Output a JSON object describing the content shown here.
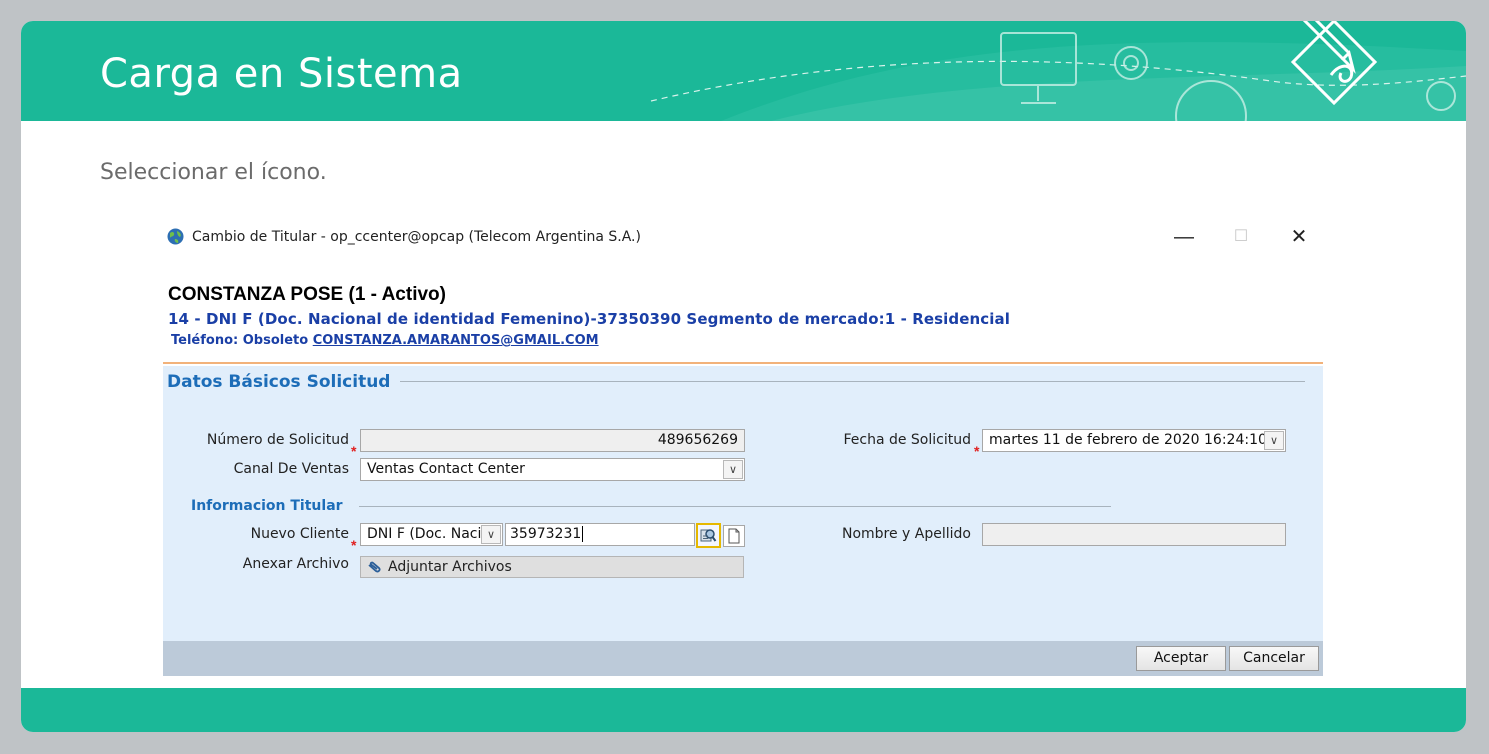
{
  "slide": {
    "title": "Carga en Sistema",
    "instruction": "Seleccionar el ícono.",
    "accent_color": "#1bb898"
  },
  "window": {
    "title": "Cambio de Titular - op_ccenter@opcap (Telecom Argentina S.A.)",
    "controls": {
      "minimize": "—",
      "maximize": "☐",
      "close": "✕"
    }
  },
  "customer": {
    "name": "CONSTANZA POSE (1 - Activo)",
    "doc_line": "14 - DNI F (Doc. Nacional de identidad Femenino)-37350390 Segmento de mercado:1 - Residencial",
    "phone_label": "Teléfono: Obsoleto",
    "email": "CONSTANZA.AMARANTOS@GMAIL.COM"
  },
  "form": {
    "section_title": "Datos Básicos Solicitud",
    "numero_label": "Número de Solicitud",
    "numero_value": "489656269",
    "fecha_label": "Fecha de Solicitud",
    "fecha_value": "martes 11 de febrero de 2020 16:24:10",
    "canal_label": "Canal De Ventas",
    "canal_value": "Ventas Contact Center",
    "subsection_title": "Informacion Titular",
    "nuevo_label": "Nuevo Cliente",
    "doc_type_value": "DNI F (Doc. Naci",
    "doc_number_value": "35973231",
    "nombre_label": "Nombre y Apellido",
    "nombre_value": "",
    "anexar_label": "Anexar Archivo",
    "attach_label": "Adjuntar Archivos",
    "required_mark": "*"
  },
  "actions": {
    "accept": "Aceptar",
    "cancel": "Cancelar"
  }
}
